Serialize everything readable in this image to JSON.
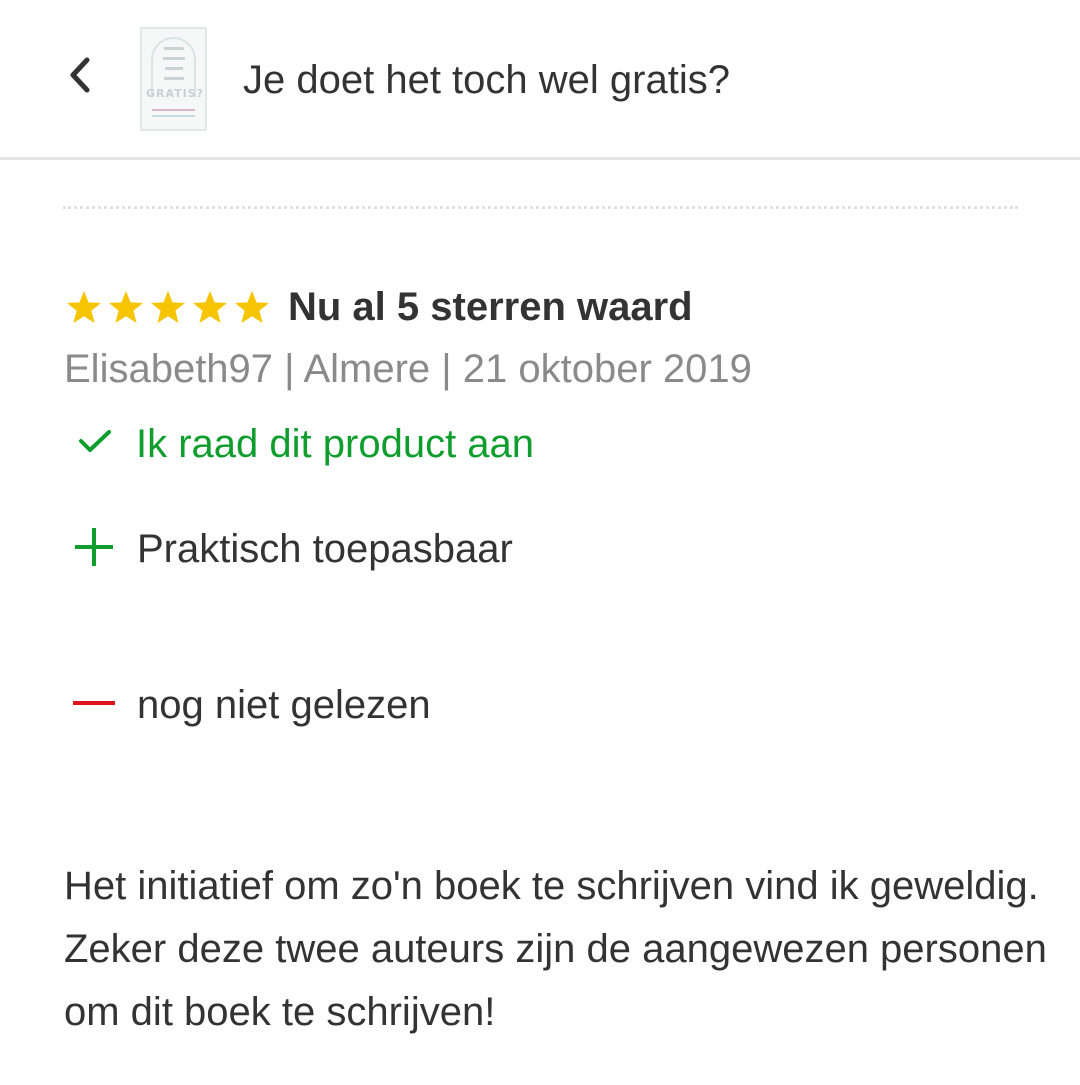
{
  "header": {
    "title": "Je doet het toch wel gratis?",
    "back_icon": "chevron-left-icon",
    "cover_text": "GRATIS?"
  },
  "review": {
    "rating": 5,
    "rating_max": 5,
    "star_color": "#f7c400",
    "title": "Nu al 5 sterren waard",
    "meta": "Elisabeth97 | Almere | 21 oktober 2019",
    "recommend": {
      "icon": "checkmark-icon",
      "text": "Ik raad dit product aan",
      "color": "#0f9d2e"
    },
    "pros": [
      {
        "icon": "plus-icon",
        "text": "Praktisch toepasbaar",
        "color": "#0f9d2e"
      }
    ],
    "cons": [
      {
        "icon": "minus-icon",
        "text": "nog niet gelezen",
        "color": "#e0141e"
      }
    ],
    "body": "Het initiatief om zo'n boek te schrijven vind ik geweldig. Zeker deze twee auteurs zijn de aangewezen personen om dit boek te schrijven!"
  }
}
